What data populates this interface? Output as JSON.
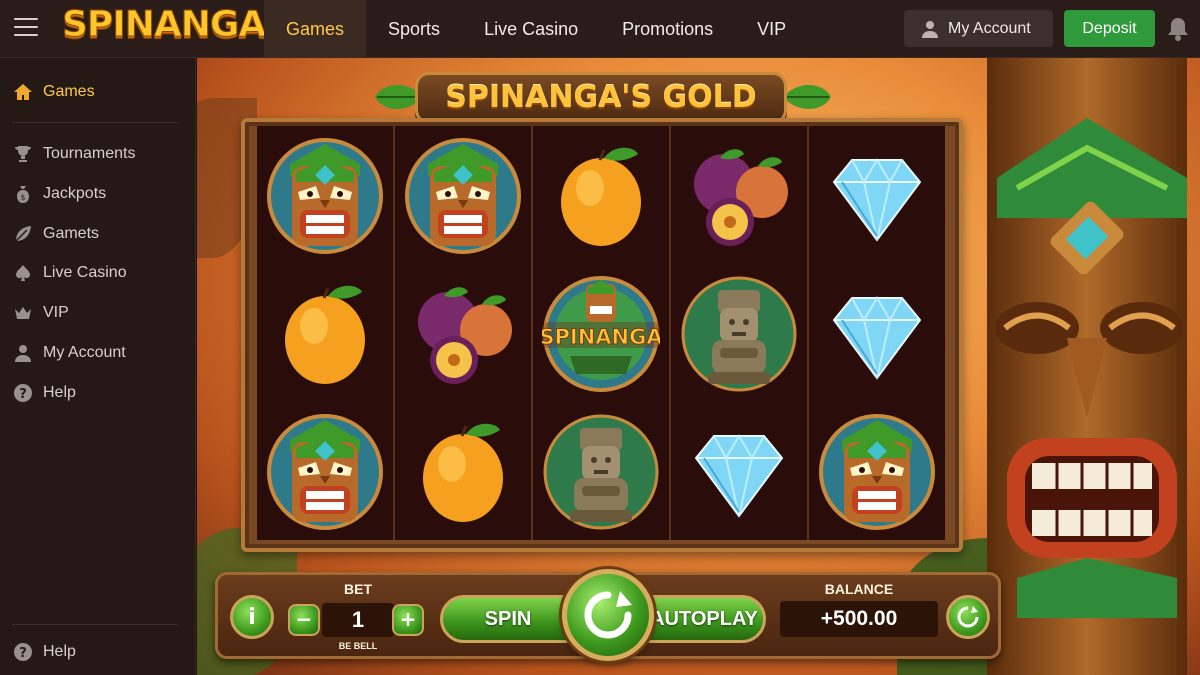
{
  "brand": {
    "logo_text": "SPINANGA"
  },
  "nav": {
    "items": [
      {
        "label": "Games",
        "active": true
      },
      {
        "label": "Sports",
        "active": false
      },
      {
        "label": "Live Casino",
        "active": false
      },
      {
        "label": "Promotions",
        "active": false
      },
      {
        "label": "VIP",
        "active": false
      }
    ]
  },
  "header": {
    "account_label": "My Account",
    "deposit_label": "Deposit"
  },
  "sidebar": {
    "items": [
      {
        "label": "Games",
        "icon": "home-icon",
        "active": true
      },
      {
        "label": "Tournaments",
        "icon": "trophy-icon"
      },
      {
        "label": "Jackpots",
        "icon": "money-bag-icon"
      },
      {
        "label": "Gamets",
        "icon": "leaf-icon"
      },
      {
        "label": "Live Casino",
        "icon": "spade-icon"
      },
      {
        "label": "VIP",
        "icon": "crown-icon"
      },
      {
        "label": "My Account",
        "icon": "user-icon"
      },
      {
        "label": "Help",
        "icon": "help-icon"
      }
    ],
    "footer_help": "Help"
  },
  "game": {
    "title": "SPINANGA'S GOLD",
    "reels": [
      [
        "tiki",
        "orange",
        "tiki"
      ],
      [
        "tiki",
        "passionfruit",
        "orange"
      ],
      [
        "orange",
        "spinanga-logo",
        "idol"
      ],
      [
        "passionfruit",
        "idol",
        "diamond"
      ],
      [
        "diamond",
        "diamond",
        "tiki"
      ]
    ],
    "logo_symbol_text": "SPINANGA"
  },
  "controls": {
    "info_label": "i",
    "bet_label": "BET",
    "bet_value": "1",
    "bet_sub": "BE BELL",
    "minus_label": "−",
    "plus_label": "+",
    "spin_label": "SPIN",
    "autoplay_label": "AUTOPLAY",
    "balance_label": "BALANCE",
    "balance_value": "+500.00"
  },
  "colors": {
    "accent_gold": "#ffc94a",
    "deposit_green": "#2f9a3c",
    "panel_dark": "#241915"
  }
}
